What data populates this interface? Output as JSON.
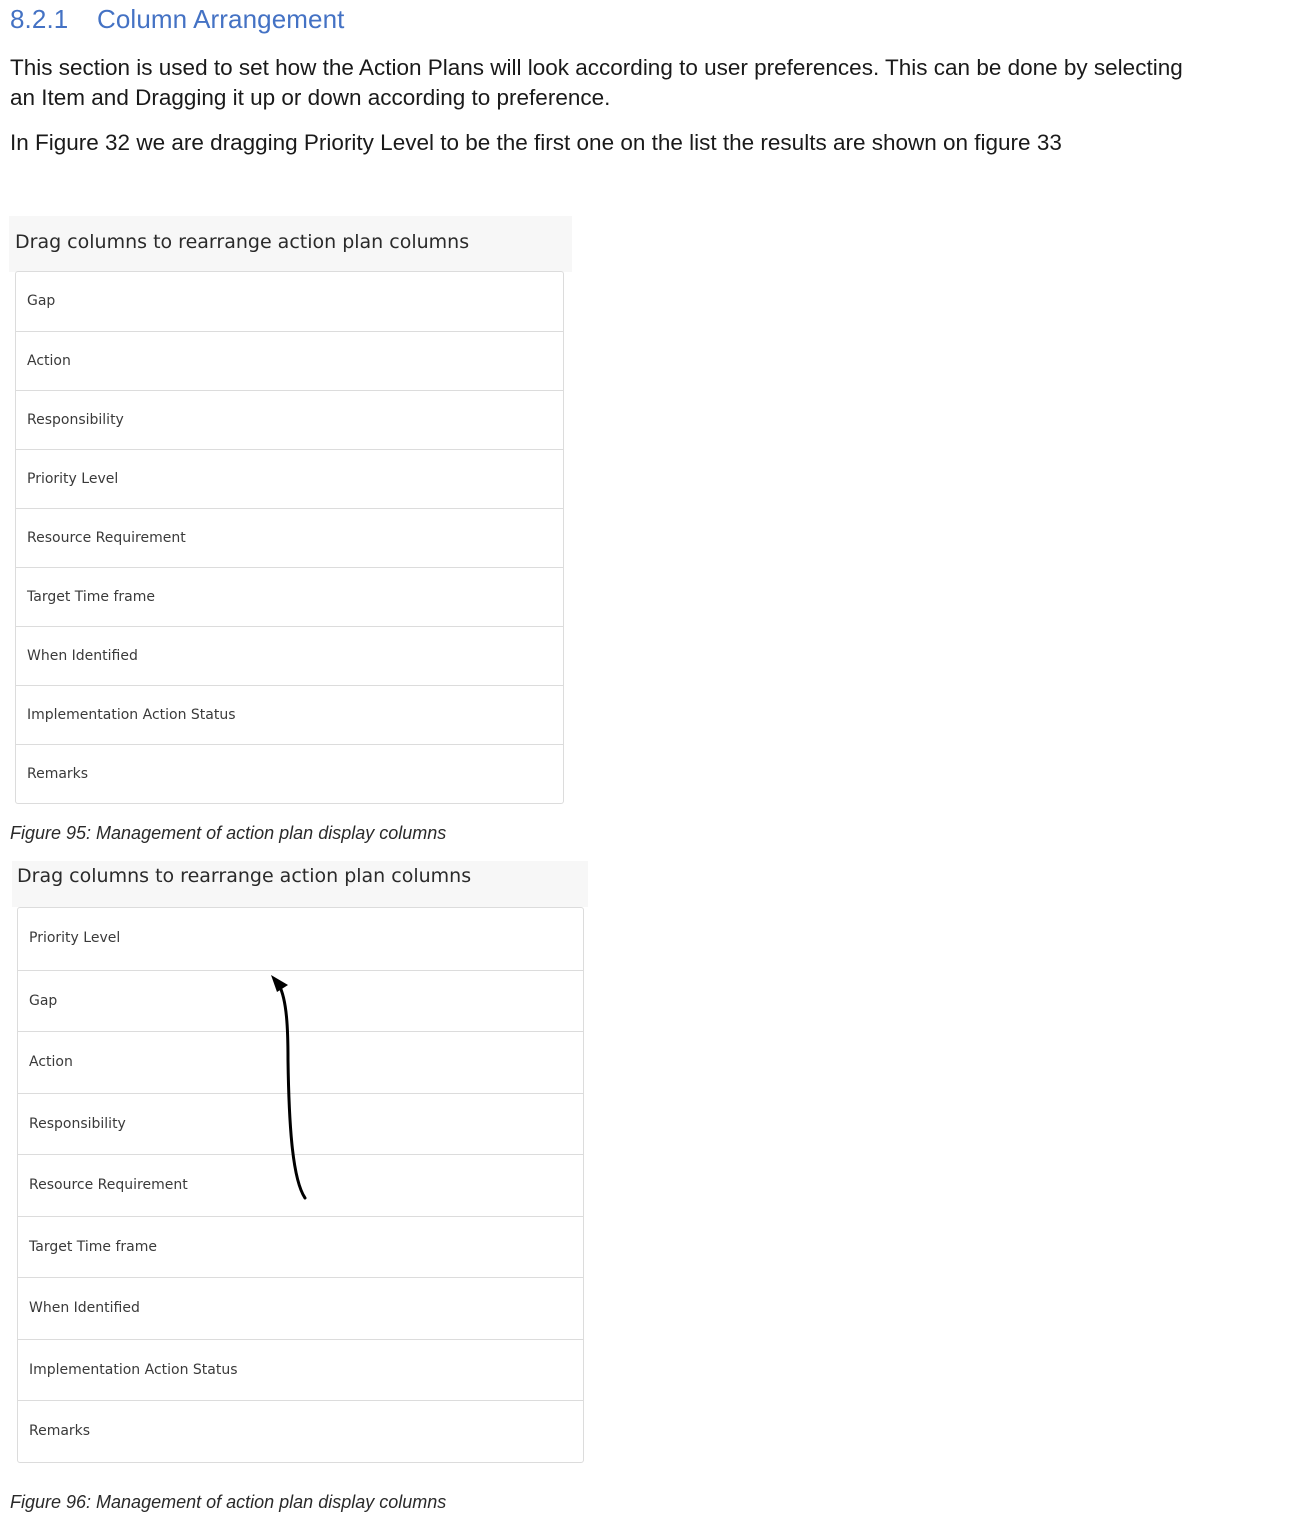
{
  "section": {
    "number": "8.2.1",
    "title": "Column Arrangement"
  },
  "paragraphs": {
    "p1_line1": "This section is used to set how the Action Plans will look according to user preferences. This can be done by selecting",
    "p1_line2": "an Item and Dragging it up or down according to preference.",
    "p2": "In Figure 32 we are dragging Priority Level to be the first one on the list the results are shown on figure 33"
  },
  "figure95": {
    "panel_title": "Drag columns to rearrange action plan columns",
    "columns": [
      "Gap",
      "Action",
      "Responsibility",
      "Priority Level",
      "Resource Requirement",
      "Target Time frame",
      "When Identified",
      "Implementation Action Status",
      "Remarks"
    ],
    "caption": "Figure 95: Management of action plan display columns"
  },
  "figure96": {
    "panel_title": "Drag columns to rearrange action plan columns",
    "columns": [
      "Priority Level",
      "Gap",
      "Action",
      "Responsibility",
      "Resource Requirement",
      "Target Time frame",
      "When Identified",
      "Implementation Action Status",
      "Remarks"
    ],
    "caption": "Figure 96: Management of action plan display columns"
  },
  "colors": {
    "heading": "#4472c4",
    "body_text": "#1a1a1a",
    "panel_header_bg": "#f7f7f7",
    "list_border": "#dcdcdc",
    "arrow": "#000000"
  },
  "icons": {
    "drag_arrow": "up-arrow-icon"
  }
}
